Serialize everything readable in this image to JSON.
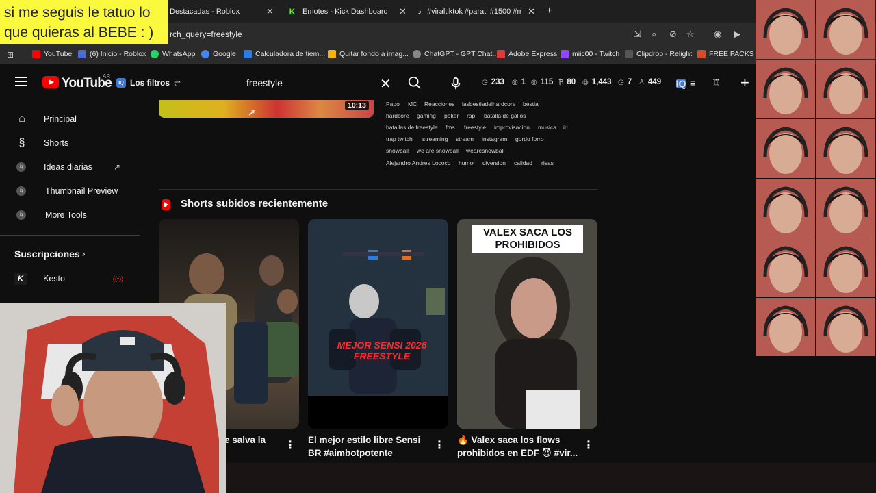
{
  "overlay_caption": "si me seguis le tatuo lo que quieras al BEBE : )",
  "browser": {
    "tabs": [
      {
        "title": "Destacadas - Roblox",
        "icon": ""
      },
      {
        "title": "Emotes - Kick Dashboard",
        "icon": "K"
      },
      {
        "title": "#viraltiktok #parati #1500 #me",
        "icon": "♪"
      }
    ],
    "new_tab_icon": "+",
    "url": "rch_query=freestyle",
    "bookmarks": [
      {
        "label": "YouTube",
        "color": "#ff0000"
      },
      {
        "label": "(6) Inicio - Roblox",
        "color": "#4a6cd4"
      },
      {
        "label": "WhatsApp",
        "color": "#25d366"
      },
      {
        "label": "Google",
        "color": "#4285f4"
      },
      {
        "label": "Calculadora de tiem...",
        "color": "#2a7de1"
      },
      {
        "label": "Quitar fondo a imag...",
        "color": "#f5b400"
      },
      {
        "label": "ChatGPT - GPT Chat...",
        "color": "#888888"
      },
      {
        "label": "Adobe Express",
        "color": "#e03a3a"
      },
      {
        "label": "miic00 - Twitch",
        "color": "#9146ff"
      },
      {
        "label": "Clipdrop - Relight",
        "color": "#222222"
      },
      {
        "label": "FREE PACKS - Cl",
        "color": "#d84a2a"
      }
    ]
  },
  "youtube": {
    "logo_text": "YouTube",
    "country": "AR",
    "filters_label": "Los filtros",
    "search_value": "freestyle",
    "stats": [
      {
        "icon": "◷",
        "value": "233"
      },
      {
        "icon": "◎",
        "value": "1"
      },
      {
        "icon": "◎",
        "value": "115"
      },
      {
        "icon": "₿",
        "value": "80"
      },
      {
        "icon": "◎",
        "value": "1,443"
      },
      {
        "icon": "◷",
        "value": "7"
      },
      {
        "icon": "♙",
        "value": "449"
      }
    ],
    "sidebar": {
      "items": [
        {
          "label": "Principal",
          "icon": "⌂"
        },
        {
          "label": "Shorts",
          "icon": "§"
        },
        {
          "label": "Ideas diarias",
          "icon": "iq"
        },
        {
          "label": "Thumbnail Preview",
          "icon": "iq"
        },
        {
          "label": "More Tools",
          "icon": "iq"
        }
      ],
      "subscriptions_title": "Suscripciones",
      "subscriptions": [
        {
          "name": "Kesto",
          "avatar": "K"
        }
      ]
    },
    "video": {
      "duration": "10:13",
      "tags": [
        "Papo",
        "MC",
        "Reacciones",
        "lasbestiadelhardcore",
        "bestia",
        "hardcore",
        "gaming",
        "poker",
        "rap",
        "batalla de gallos",
        "batallas de freestyle",
        "fms",
        "freestyle",
        "improvisacion",
        "musica",
        "irl",
        "trap twitch",
        "streaming",
        "stream",
        "instagram",
        "gordo forro",
        "snowball",
        "we are snowball",
        "wearesnowball",
        "Alejandro Andres Lococo",
        "humor",
        "diversion",
        "calidad",
        "risas"
      ]
    },
    "shorts_section_title": "Shorts subidos recientemente",
    "shorts": [
      {
        "title": "e salva la",
        "overlay": ""
      },
      {
        "title": "El mejor estilo libre Sensi",
        "subtitle": "BR #aimbotpotente",
        "overlay": "MEJOR SENSI 2026 FREESTYLE"
      },
      {
        "title": "🔥 Valex saca los flows",
        "subtitle": "prohibidos en EDF 😈 #vir...",
        "overlay": "VALEX SACA LOS PROHIBIDOS"
      }
    ]
  },
  "colors": {
    "yt_red": "#ff0000",
    "caption_bg": "#fbf93e",
    "bg": "#0f0f0f"
  }
}
